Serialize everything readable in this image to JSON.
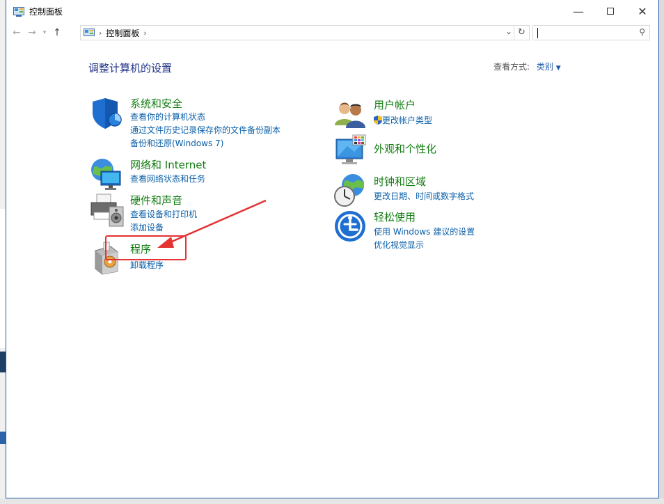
{
  "window": {
    "title": "控制面板"
  },
  "address": {
    "path": "控制面板"
  },
  "heading": "调整计算机的设置",
  "view_by": {
    "label": "查看方式:",
    "value": "类别"
  },
  "left_categories": [
    {
      "title": "系统和安全",
      "links": [
        "查看你的计算机状态",
        "通过文件历史记录保存你的文件备份副本",
        "备份和还原(Windows 7)"
      ]
    },
    {
      "title": "网络和 Internet",
      "links": [
        "查看网络状态和任务"
      ]
    },
    {
      "title": "硬件和声音",
      "links": [
        "查看设备和打印机",
        "添加设备"
      ]
    },
    {
      "title": "程序",
      "links": [
        "卸载程序"
      ]
    }
  ],
  "right_categories": [
    {
      "title": "用户帐户",
      "links": [
        "更改帐户类型"
      ]
    },
    {
      "title": "外观和个性化",
      "links": []
    },
    {
      "title": "时钟和区域",
      "links": [
        "更改日期、时间或数字格式"
      ]
    },
    {
      "title": "轻松使用",
      "links": [
        "使用 Windows 建议的设置",
        "优化视觉显示"
      ]
    }
  ],
  "colors": {
    "title_green": "#107c10",
    "link_blue": "#0a5fa8",
    "heading_blue": "#1e3287",
    "annotation_red": "#e53232"
  }
}
